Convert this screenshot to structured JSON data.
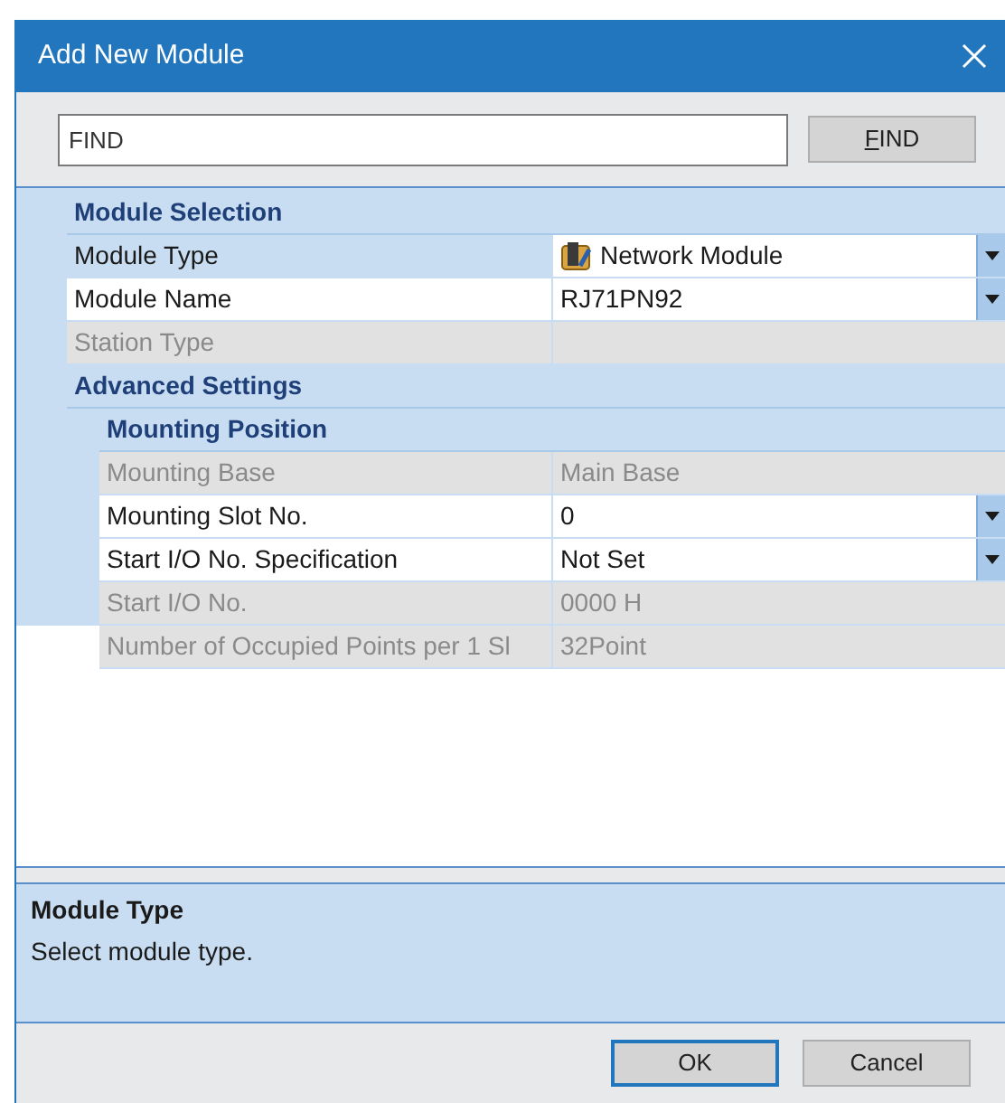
{
  "window": {
    "title": "Add New Module"
  },
  "search": {
    "value": "FIND",
    "button": "FIND"
  },
  "sections": [
    {
      "title": "Module Selection",
      "rows": [
        {
          "label": "Module Type",
          "value": "Network Module",
          "disabled": false,
          "dropdown": true,
          "selected": true,
          "icon": true
        },
        {
          "label": "Module Name",
          "value": "RJ71PN92",
          "disabled": false,
          "dropdown": true,
          "selected": false
        },
        {
          "label": "Station Type",
          "value": "",
          "disabled": true,
          "selected": false
        }
      ]
    },
    {
      "title": "Advanced Settings",
      "children": [
        {
          "title": "Mounting Position",
          "rows": [
            {
              "label": "Mounting Base",
              "value": "Main Base",
              "disabled": true,
              "selected": false
            },
            {
              "label": "Mounting Slot No.",
              "value": "0",
              "disabled": false,
              "dropdown": true,
              "selected": false
            },
            {
              "label": "Start I/O No. Specification",
              "value": "Not Set",
              "disabled": false,
              "dropdown": true,
              "selected": false
            },
            {
              "label": "Start I/O No.",
              "value": "0000 H",
              "disabled": true,
              "selected": false
            },
            {
              "label": "Number of Occupied Points per 1 Sl",
              "value": "32Point",
              "disabled": true,
              "selected": false
            }
          ]
        }
      ]
    }
  ],
  "description": {
    "title": "Module Type",
    "text": "Select module type."
  },
  "buttons": [
    {
      "label": "OK",
      "selected": true
    },
    {
      "label": "Cancel",
      "selected": false
    }
  ]
}
